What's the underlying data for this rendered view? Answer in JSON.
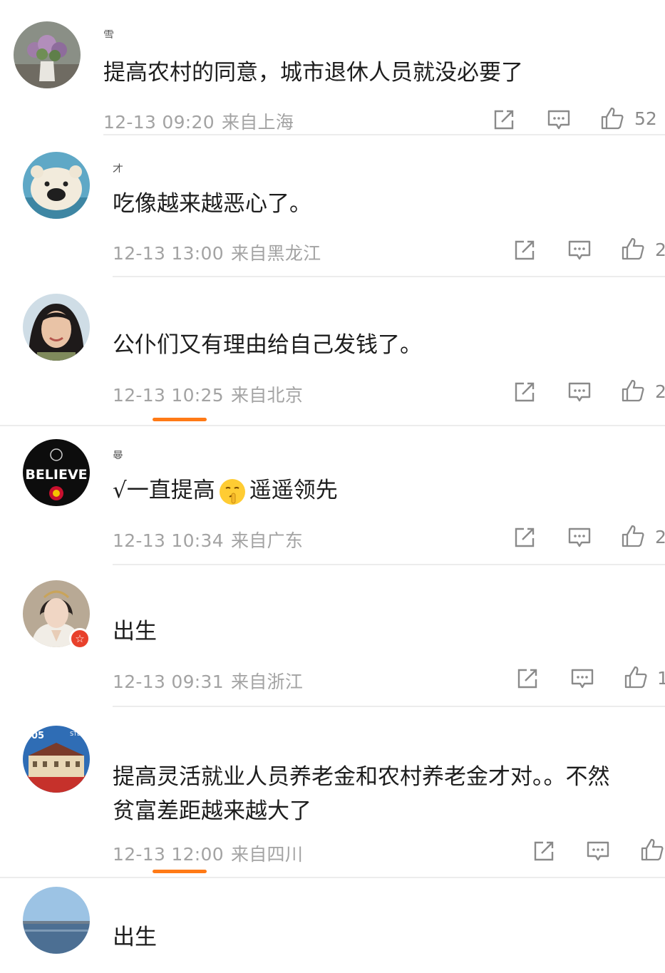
{
  "comments": [
    {
      "username": "雪",
      "text": "提高农村的同意，城市退休人员就没必要了",
      "date": "12-13 09:20",
      "location": "来自上海",
      "likes": "52",
      "avatar_icon": "flower-vase-icon"
    },
    {
      "username": "才",
      "text": "吃像越来越恶心了。",
      "date": "12-13 13:00",
      "location": "来自黑龙江",
      "likes": "2",
      "avatar_icon": "polar-bear-icon"
    },
    {
      "username": "",
      "text": "公仆们又有理由给自己发钱了。",
      "date": "12-13 10:25",
      "location": "来自北京",
      "likes": "2",
      "avatar_icon": "woman-portrait-icon"
    },
    {
      "username": "曼",
      "text_before": "√一直提高",
      "text_after": "遥遥领先",
      "date": "12-13 10:34",
      "location": "来自广东",
      "likes": "2",
      "avatar_icon": "believe-badge-icon",
      "avatar_text": "BELIEVE"
    },
    {
      "username": "",
      "text": "出生",
      "date": "12-13 09:31",
      "location": "来自浙江",
      "likes": "1",
      "avatar_icon": "costume-portrait-icon",
      "badge_icon": "star-icon"
    },
    {
      "username": "",
      "text_line1": "提高灵活就业人员养老金和农村养老金才对。。不然",
      "text_line2": "贫富差距越来越大了",
      "date": "12-13 12:00",
      "location": "来自四川",
      "likes": "",
      "avatar_icon": "building-icon",
      "avatar_text": "05",
      "avatar_text2": "STE"
    },
    {
      "username": "",
      "text": "出生",
      "avatar_icon": "lake-landscape-icon"
    }
  ],
  "colors": {
    "accent": "#ff7a16",
    "meta": "#a3a3a3",
    "text": "#1d1d1d",
    "divider": "#ececec"
  }
}
